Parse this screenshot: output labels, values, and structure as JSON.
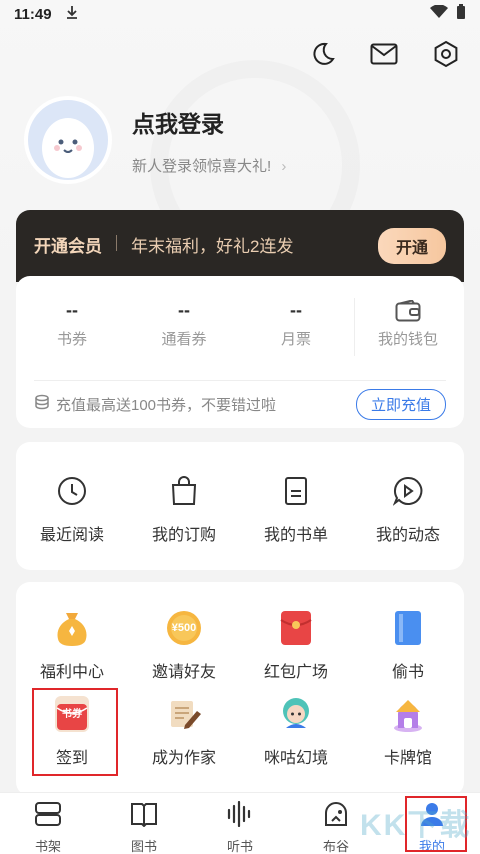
{
  "status": {
    "time": "11:49"
  },
  "profile": {
    "title": "点我登录",
    "subtitle": "新人登录领惊喜大礼!",
    "chevron": "›"
  },
  "vip": {
    "title": "开通会员",
    "desc": "年末福利，好礼2连发",
    "button": "开通"
  },
  "wallet": {
    "items": [
      {
        "value": "--",
        "label": "书券"
      },
      {
        "value": "--",
        "label": "通看券"
      },
      {
        "value": "--",
        "label": "月票"
      },
      {
        "value": "",
        "label": "我的钱包"
      }
    ],
    "recharge_text": "充值最高送100书券，不要错过啦",
    "recharge_button": "立即充值"
  },
  "shortcuts": [
    {
      "label": "最近阅读",
      "icon": "clock-icon"
    },
    {
      "label": "我的订购",
      "icon": "shopping-bag-icon"
    },
    {
      "label": "我的书单",
      "icon": "document-icon"
    },
    {
      "label": "我的动态",
      "icon": "play-bubble-icon"
    }
  ],
  "tools": [
    {
      "label": "福利中心",
      "icon": "money-bag-icon"
    },
    {
      "label": "邀请好友",
      "icon": "coin-500-icon",
      "icon_text": "¥500"
    },
    {
      "label": "红包广场",
      "icon": "red-envelope-icon"
    },
    {
      "label": "偷书",
      "icon": "book-icon"
    },
    {
      "label": "签到",
      "icon": "sign-in-icon",
      "icon_text": "书券"
    },
    {
      "label": "成为作家",
      "icon": "scroll-pen-icon"
    },
    {
      "label": "咪咕幻境",
      "icon": "avatar-character-icon"
    },
    {
      "label": "卡牌馆",
      "icon": "card-hall-icon"
    }
  ],
  "tabs": [
    {
      "label": "书架",
      "icon": "bookshelf-icon"
    },
    {
      "label": "图书",
      "icon": "open-book-icon"
    },
    {
      "label": "听书",
      "icon": "sound-wave-icon"
    },
    {
      "label": "布谷",
      "icon": "cuckoo-icon"
    },
    {
      "label": "我的",
      "icon": "person-icon",
      "active": true
    }
  ],
  "colors": {
    "accent": "#3b7be8",
    "highlight": "#e0262a",
    "vip_bg": "#2a2724"
  },
  "watermark": "KK下载"
}
